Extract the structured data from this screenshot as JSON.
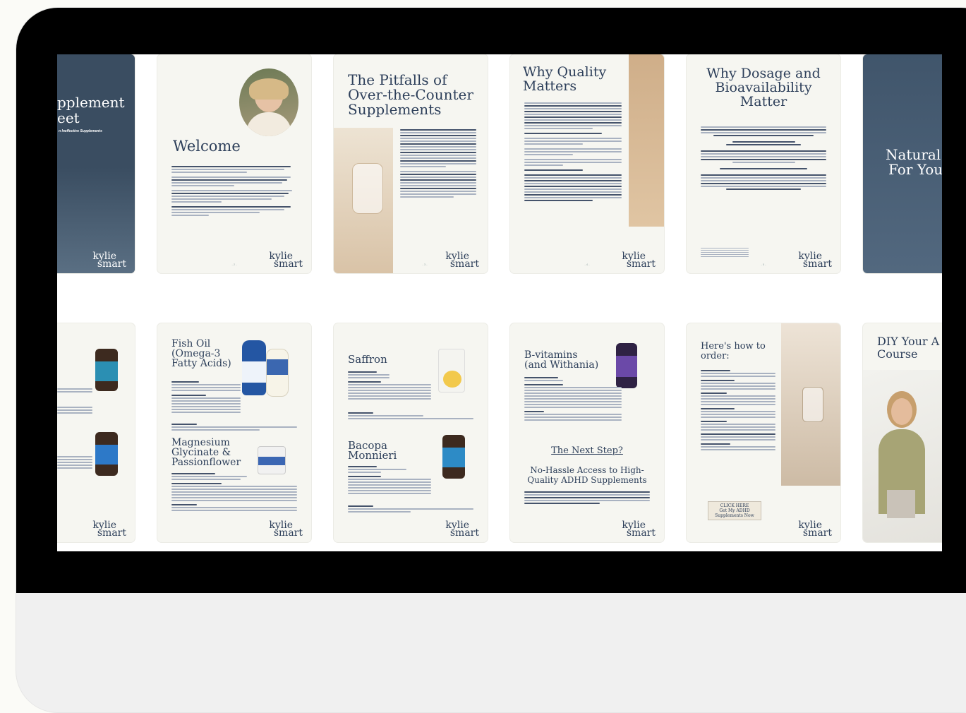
{
  "pages": {
    "cover": {
      "title_line1": "pplement",
      "title_line2": "eet",
      "subtitle": "n Ineffective Supplements",
      "logo_top": "kylie",
      "logo_bottom": "smart"
    },
    "welcome": {
      "title": "Welcome",
      "logo_top": "kylie",
      "logo_bottom": "smart",
      "page_num": "- 2 -"
    },
    "pitfalls": {
      "title_line1": "The Pitfalls of",
      "title_line2": "Over-the-Counter",
      "title_line3": "Supplements",
      "logo_top": "kylie",
      "logo_bottom": "smart",
      "page_num": "- 3 -"
    },
    "quality": {
      "title_line1": "Why Quality",
      "title_line2": "Matters",
      "logo_top": "kylie",
      "logo_bottom": "smart",
      "page_num": "- 4 -"
    },
    "dosage": {
      "title_line1": "Why Dosage and",
      "title_line2": "Bioavailability",
      "title_line3": "Matter",
      "logo_top": "kylie",
      "logo_bottom": "smart",
      "page_num": "- 5 -"
    },
    "natural": {
      "title_line1": "Natural S",
      "title_line2": "For You"
    },
    "supp_left": {
      "logo_top": "kylie",
      "logo_bottom": "smart"
    },
    "fishoil": {
      "title1_line1": "Fish Oil",
      "title1_line2": "(Omega-3",
      "title1_line3": "Fatty Acids)",
      "title2_line1": "Magnesium",
      "title2_line2": "Glycinate &",
      "title2_line3": "Passionflower",
      "logo_top": "kylie",
      "logo_bottom": "smart"
    },
    "saffron": {
      "title1": "Saffron",
      "title2_line1": "Bacopa",
      "title2_line2": "Monnieri",
      "logo_top": "kylie",
      "logo_bottom": "smart"
    },
    "bvitamins": {
      "title_line1": "B-vitamins",
      "title_line2": "(and Withania)",
      "next_step": "The Next Step?",
      "hassle_line1": "No-Hassle Access to High-",
      "hassle_line2": "Quality ADHD Supplements",
      "logo_top": "kylie",
      "logo_bottom": "smart"
    },
    "order": {
      "title_line1": "Here's how to",
      "title_line2": "order:",
      "cta_line1": "CLICK HERE",
      "cta_line2": "Get My ADHD",
      "cta_line3": "Supplements Now",
      "logo_top": "kylie",
      "logo_bottom": "smart"
    },
    "diy": {
      "title_line1": "DIY Your A",
      "title_line2": "Course"
    }
  }
}
